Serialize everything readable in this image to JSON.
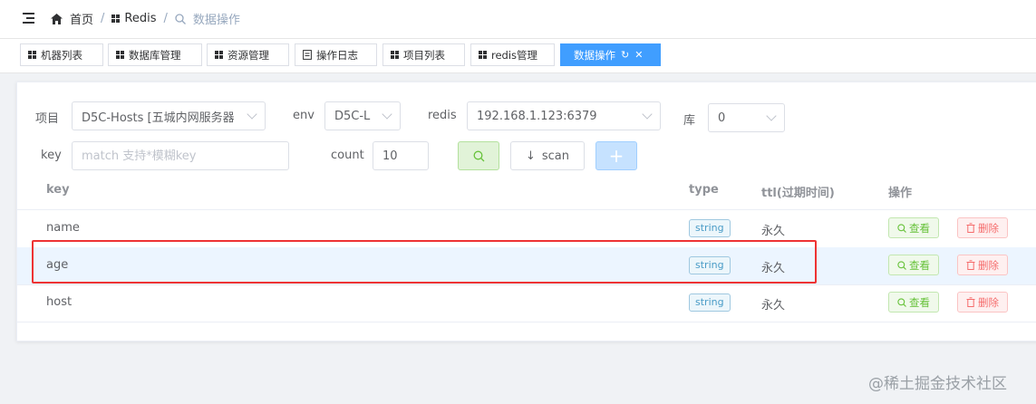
{
  "breadcrumb": {
    "home": "首页",
    "sep1": "/",
    "redis": "Redis",
    "sep2": "/",
    "current": "数据操作"
  },
  "tabs": [
    {
      "label": "机器列表",
      "icon": "grid-icon"
    },
    {
      "label": "数据库管理",
      "icon": "grid-icon"
    },
    {
      "label": "资源管理",
      "icon": "grid-icon"
    },
    {
      "label": "操作日志",
      "icon": "document-icon"
    },
    {
      "label": "项目列表",
      "icon": "grid-icon"
    },
    {
      "label": "redis管理",
      "icon": "grid-icon"
    },
    {
      "label": "数据操作",
      "icon": "grid-icon",
      "active": true
    }
  ],
  "filters": {
    "project_label": "项目",
    "project_value": "D5C-Hosts [五城内网服务器",
    "env_label": "env",
    "env_value": "D5C-L",
    "redis_label": "redis",
    "redis_value": "192.168.1.123:6379",
    "db_label": "库",
    "db_value": "0",
    "key_label": "key",
    "key_placeholder": "match 支持*模糊key",
    "count_label": "count",
    "count_value": "10",
    "scan_label": "scan",
    "add_label": "+"
  },
  "table": {
    "columns": [
      "key",
      "type",
      "ttl(过期时间)",
      "操作"
    ],
    "rows": [
      {
        "key": "name",
        "type": "string",
        "ttl": "永久",
        "view": "查看",
        "delete": "删除"
      },
      {
        "key": "age",
        "type": "string",
        "ttl": "永久",
        "view": "查看",
        "delete": "删除",
        "highlighted": true
      },
      {
        "key": "host",
        "type": "string",
        "ttl": "永久",
        "view": "查看",
        "delete": "删除"
      }
    ]
  },
  "colors": {
    "primary": "#409eff",
    "success": "#67c23a",
    "danger": "#f56c6c",
    "highlight_box": "#ee3333"
  },
  "watermark": "@稀土掘金技术社区"
}
